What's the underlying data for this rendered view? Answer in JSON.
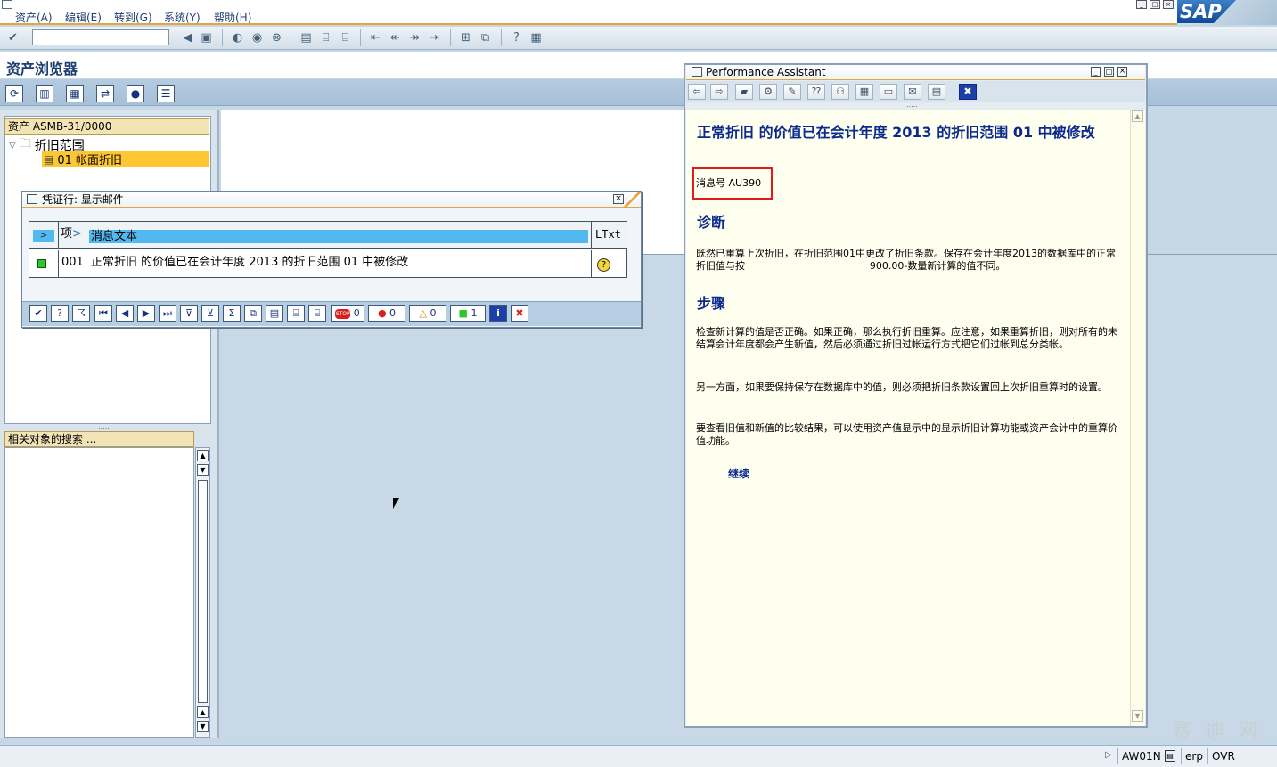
{
  "menubar": {
    "items": [
      "资产(A)",
      "编辑(E)",
      "转到(G)",
      "系统(Y)",
      "帮助(H)"
    ],
    "logo": "SAP"
  },
  "page": {
    "title": "资产浏览器"
  },
  "tree": {
    "header": "资产 ASMB-31/0000",
    "root": "折旧范围",
    "selected": "01  帐面折旧"
  },
  "search": {
    "header": "相关对象的搜索 ..."
  },
  "modal": {
    "title": "凭证行: 显示邮件",
    "columns": {
      "item": "项",
      "text": "消息文本",
      "ltxt": "LTxt"
    },
    "row": {
      "item": "001",
      "text": "正常折旧 的价值已在会计年度 2013 的折旧范围 01 中被修改"
    },
    "counts": {
      "stop": "0",
      "error": "0",
      "warning": "0",
      "success": "1"
    }
  },
  "assistant": {
    "title": "Performance Assistant",
    "heading": "正常折旧 的价值已在会计年度 2013 的折旧范围 01 中被修改",
    "message_no": "消息号 AU390",
    "diag_title": "诊断",
    "diag_text": "既然已重算上次折旧，在折旧范围01中更改了折旧条款。保存在会计年度2013的数据库中的正常折旧值与按                                        900.00-数量新计算的值不同。",
    "steps_title": "步骤",
    "steps_text1": "检查新计算的值是否正确。如果正确，那么执行折旧重算。应注意，如果重算折旧，则对所有的未结算会计年度都会产生新值，然后必须通过折旧过帐运行方式把它们过帐到总分类帐。",
    "steps_text2": "另一方面，如果要保持保存在数据库中的值，则必须把折旧条款设置回上次折旧重算时的设置。",
    "steps_text3": "要查看旧值和新值的比较结果，可以使用资产值显示中的显示折旧计算功能或资产会计中的重算价值功能。",
    "continue": "继续"
  },
  "status": {
    "tcode": "AW01N",
    "server": "erp",
    "mode": "OVR"
  },
  "watermark": "赛 迪 网"
}
